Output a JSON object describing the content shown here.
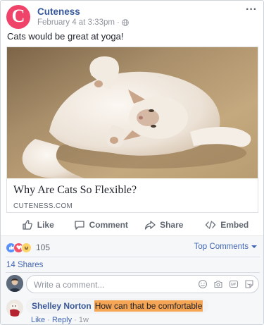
{
  "post": {
    "page_name": "Cuteness",
    "timestamp": "February 4 at 3:33pm",
    "meta_sep": "·",
    "avatar_letter": "C",
    "more": "···",
    "text": "Cats would be great at yoga!"
  },
  "link": {
    "title": "Why Are Cats So Flexible?",
    "domain": "CUTENESS.COM"
  },
  "actions": {
    "like": "Like",
    "comment": "Comment",
    "share": "Share",
    "embed": "Embed"
  },
  "reactions": {
    "count": "105",
    "top_comments": "Top Comments"
  },
  "shares": "14 Shares",
  "comment_input": {
    "placeholder": "Write a comment..."
  },
  "comment": {
    "author": "Shelley Norton",
    "text": "How can that be comfortable",
    "like": "Like",
    "sep": " · ",
    "reply": "Reply",
    "time": "1w"
  },
  "colors": {
    "accent": "#4267b2",
    "brand": "#f0436a",
    "highlight": "#f5a554"
  }
}
